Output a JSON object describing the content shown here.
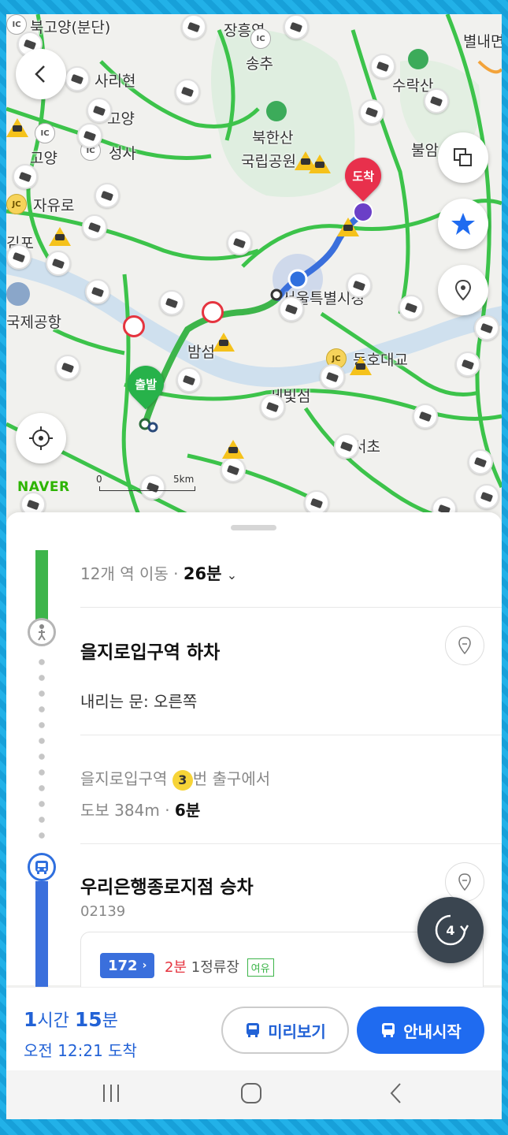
{
  "map": {
    "places": [
      {
        "id": "bukgoyang",
        "text": "북고양(분단)"
      },
      {
        "id": "jangheung",
        "text": "장흥역"
      },
      {
        "id": "songchu",
        "text": "송추"
      },
      {
        "id": "byeolnae",
        "text": "별내면"
      },
      {
        "id": "sarihyeon",
        "text": "사리현"
      },
      {
        "id": "suraksan",
        "text": "수락산"
      },
      {
        "id": "goyang1",
        "text": "고양"
      },
      {
        "id": "goyang2",
        "text": "고양"
      },
      {
        "id": "seongsa",
        "text": "성사"
      },
      {
        "id": "bukhansan",
        "text": "북한산"
      },
      {
        "id": "gungnip",
        "text": "국립공원"
      },
      {
        "id": "buram",
        "text": "불암"
      },
      {
        "id": "jayuro",
        "text": "자유로"
      },
      {
        "id": "gimpo",
        "text": "김포"
      },
      {
        "id": "seoul_hall",
        "text": "서울특별시청"
      },
      {
        "id": "airport",
        "text": "국제공항"
      },
      {
        "id": "bamseom",
        "text": "밤섬"
      },
      {
        "id": "dongho",
        "text": "동호대교"
      },
      {
        "id": "sebitseom",
        "text": "세빛섬"
      },
      {
        "id": "seocho",
        "text": "서초"
      }
    ],
    "badges": {
      "ic": "IC",
      "jc": "JC"
    },
    "start_label": "출발",
    "end_label": "도착",
    "logo": "NAVER",
    "scale": {
      "start": "0",
      "end": "5km"
    }
  },
  "route": {
    "summary_prefix": "12개 역 이동",
    "summary_time": "26분",
    "steps": [
      {
        "title": "을지로입구역 하차",
        "detail": "내리는 문: 오른쪽"
      },
      {
        "exit_prefix": "을지로입구역",
        "exit_number": "3",
        "exit_suffix": "번 출구에서",
        "walk_prefix": "도보 384m",
        "walk_time": "6분"
      },
      {
        "title": "우리은행종로지점 승차",
        "stop_id": "02139"
      }
    ],
    "bus": {
      "number": "172",
      "arrival": "2분",
      "stops": "1정류장",
      "crowd": "여유"
    }
  },
  "refresh_count": "4",
  "bottom": {
    "duration_hours_num": "1",
    "duration_hours_unit": "시간",
    "duration_min_num": "15",
    "duration_min_unit": "분",
    "arrival": "오전 12:21 도착",
    "preview_label": "미리보기",
    "start_label": "안내시작"
  },
  "colors": {
    "accent": "#1f6bf0",
    "green": "#3db54a",
    "end_pin": "#e8304c",
    "start_pin": "#27b24a"
  }
}
